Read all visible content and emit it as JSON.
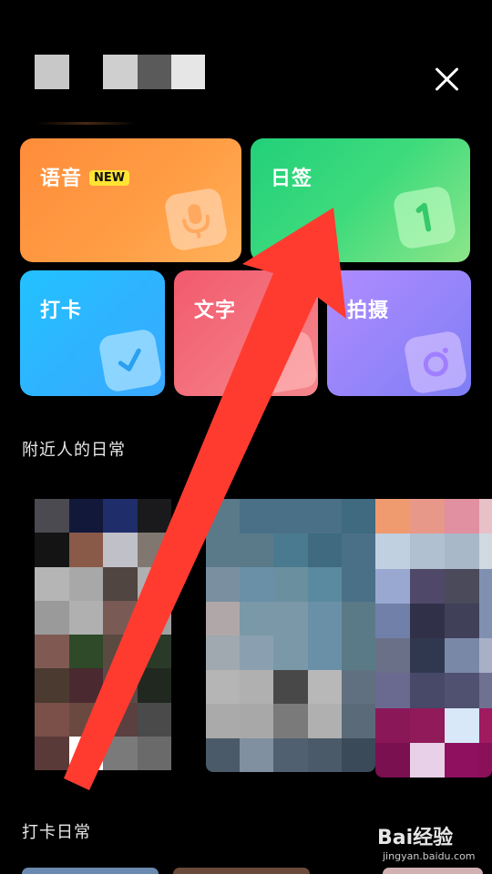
{
  "header": {
    "close_icon": "close-icon"
  },
  "cards": {
    "voice": {
      "label": "语音",
      "badge": "NEW",
      "icon": "microphone-icon",
      "color": "#ff8a3d"
    },
    "daily_sign": {
      "label": "日签",
      "icon": "number-one-icon",
      "color": "#34d27a"
    },
    "checkin": {
      "label": "打卡",
      "icon": "checkmark-icon",
      "color": "#2ab4ff"
    },
    "text": {
      "label": "文字",
      "icon": "text-icon",
      "color": "#f06274"
    },
    "photo": {
      "label": "拍摄",
      "icon": "camera-icon",
      "color": "#9b7dff"
    }
  },
  "sections": {
    "nearby": {
      "title": "附近人的日常"
    },
    "checkin_daily": {
      "title": "打卡日常"
    }
  },
  "watermark": {
    "brand": "Bai经验",
    "url": "jingyan.baidu.com"
  },
  "annotation": {
    "arrow_color": "#ff3b30"
  }
}
